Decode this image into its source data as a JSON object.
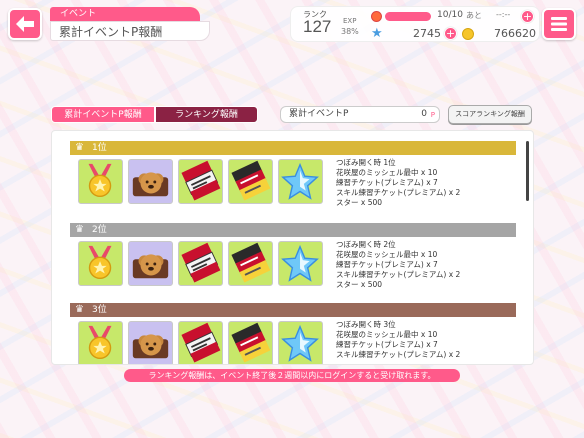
{
  "header": {
    "category_tag": "イベント",
    "title": "累計イベントP報酬"
  },
  "status": {
    "rank_label": "ランク",
    "rank_value": "127",
    "exp_label": "EXP",
    "exp_percent": "38%",
    "stamina_text": "10/10",
    "stamina_fraction": 1.0,
    "stamina_remain_label": "あと",
    "stamina_timer": "--:--",
    "stars": "2745",
    "coins": "766620",
    "plus_symbol": "+"
  },
  "tabs": [
    {
      "label": "累計イベントP報酬",
      "active": true
    },
    {
      "label": "ランキング報酬",
      "active": false
    }
  ],
  "points": {
    "label": "累計イベントP",
    "value": "0",
    "unit": "P"
  },
  "score_button_label": "スコアランキング報酬",
  "rewards": [
    {
      "rank": "1位",
      "color": "#d9b73a",
      "lines": [
        "つぼみ開く時 1位",
        "花咲屋のミッシェル最中 x 10",
        "練習チケット(プレミアム) x 7",
        "スキル練習チケット(プレミアム) x 2",
        "スター x 500"
      ]
    },
    {
      "rank": "2位",
      "color": "#a5a5a5",
      "lines": [
        "つぼみ開く時 2位",
        "花咲屋のミッシェル最中 x 10",
        "練習チケット(プレミアム) x 7",
        "スキル練習チケット(プレミアム) x 2",
        "スター x 500"
      ]
    },
    {
      "rank": "3位",
      "color": "#9a6a5a",
      "lines": [
        "つぼみ開く時 3位",
        "花咲屋のミッシェル最中 x 10",
        "練習チケット(プレミアム) x 7",
        "スキル練習チケット(プレミアム) x 2"
      ]
    }
  ],
  "item_icons": [
    "medal-icon",
    "bear-wafer-icon",
    "practice-ticket-icon",
    "skill-ticket-icon",
    "star-icon"
  ],
  "footer_note": "ランキング報酬は、イベント終了後２週間以内にログインすると受け取れます。",
  "colors": {
    "accent": "#ff5a8a",
    "tab_inactive": "#8b2244"
  }
}
